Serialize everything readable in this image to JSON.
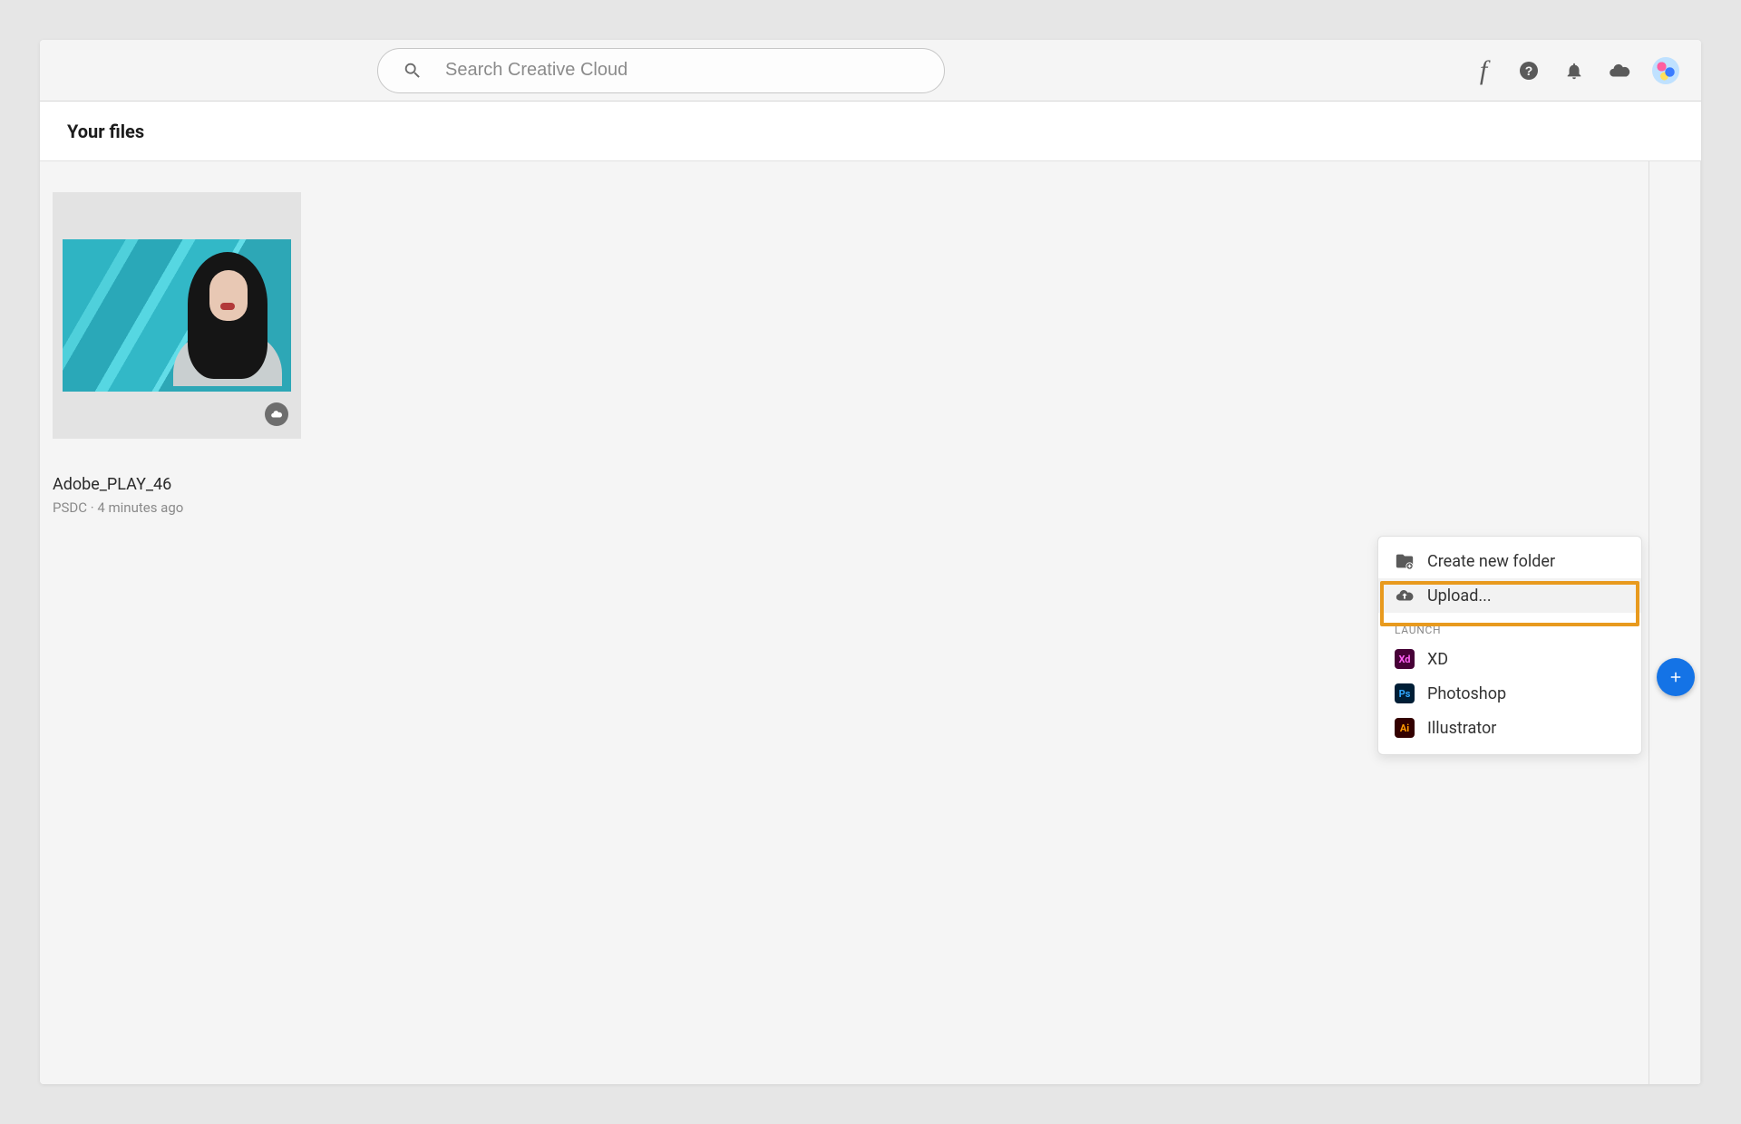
{
  "search": {
    "placeholder": "Search Creative Cloud"
  },
  "header": {
    "title": "Your files"
  },
  "file": {
    "name": "Adobe_PLAY_46",
    "meta": "PSDC · 4 minutes ago"
  },
  "menu": {
    "create_folder": "Create new folder",
    "upload": "Upload...",
    "section": "LAUNCH",
    "apps": {
      "xd": {
        "badge": "Xd",
        "label": "XD"
      },
      "ps": {
        "badge": "Ps",
        "label": "Photoshop"
      },
      "ai": {
        "badge": "Ai",
        "label": "Illustrator"
      }
    }
  }
}
